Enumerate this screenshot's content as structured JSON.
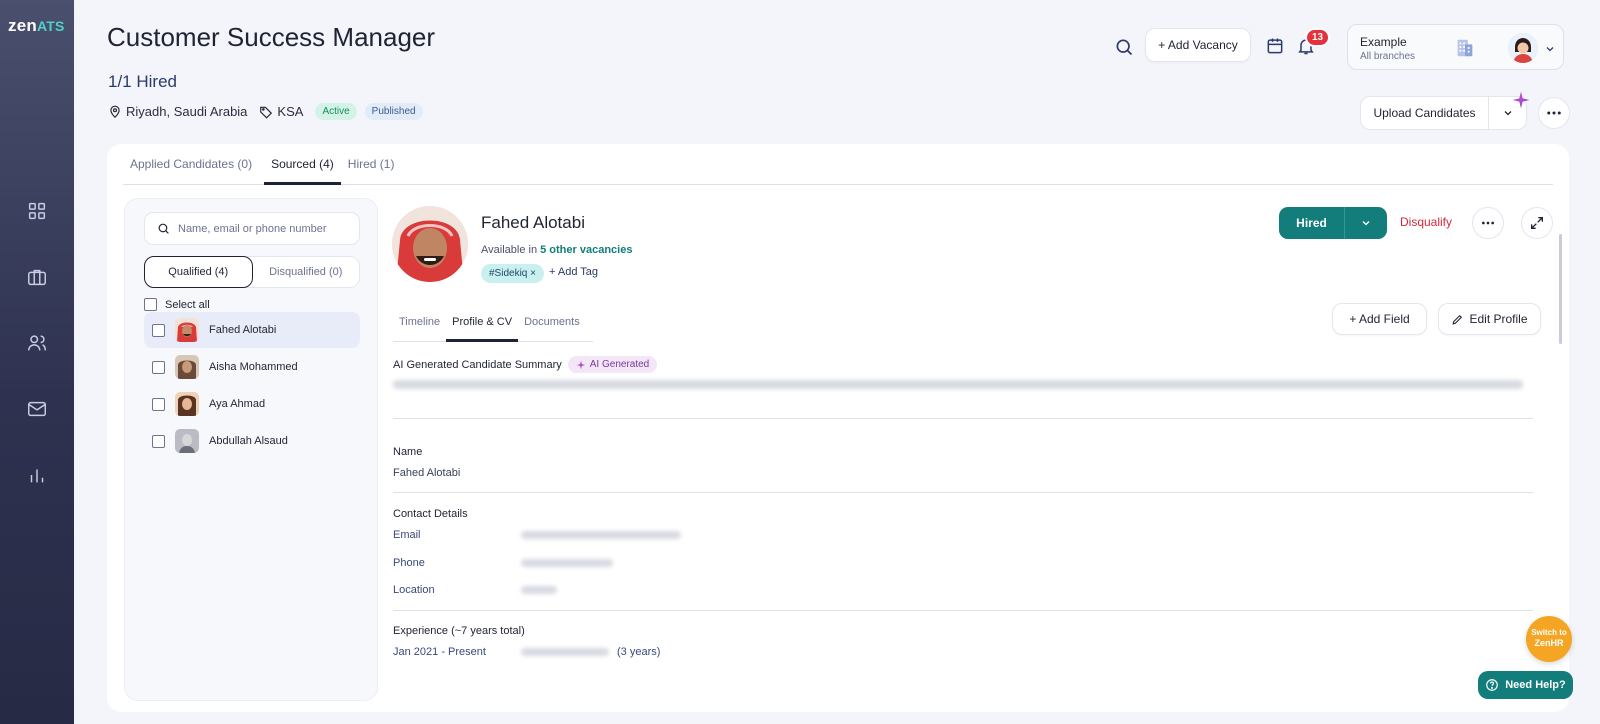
{
  "app": {
    "logo_main": "zen",
    "logo_accent": "ATS"
  },
  "sidebar": {
    "items": [
      {
        "icon": "dashboard-grid-icon"
      },
      {
        "icon": "briefcase-icon"
      },
      {
        "icon": "users-icon"
      },
      {
        "icon": "mail-icon"
      },
      {
        "icon": "bar-chart-icon"
      }
    ]
  },
  "header": {
    "title": "Customer Success Manager",
    "hired_count": "1/1 Hired",
    "location": "Riyadh, Saudi Arabia",
    "tag": "KSA",
    "status": "Active",
    "publish_status": "Published",
    "add_vacancy": "+ Add Vacancy",
    "notification_count": "13",
    "branch_name": "Example",
    "branch_sub": "All branches",
    "upload_label": "Upload Candidates"
  },
  "tabs": [
    {
      "label": "Applied Candidates (0)"
    },
    {
      "label": "Sourced (4)"
    },
    {
      "label": "Hired (1)"
    }
  ],
  "candidate_list": {
    "search_placeholder": "Name, email or phone number",
    "qualified": "Qualified (4)",
    "disqualified": "Disqualified (0)",
    "select_all": "Select all",
    "items": [
      {
        "name": "Fahed Alotabi"
      },
      {
        "name": "Aisha Mohammed"
      },
      {
        "name": "Aya Ahmad"
      },
      {
        "name": "Abdullah Alsaud"
      }
    ]
  },
  "profile": {
    "name": "Fahed Alotabi",
    "available_prefix": "Available in",
    "available_link": "5 other vacancies",
    "tag": "#Sidekiq ×",
    "add_tag": "+ Add Tag",
    "hired_label": "Hired",
    "disqualify": "Disqualify",
    "tabs": [
      {
        "label": "Timeline"
      },
      {
        "label": "Profile & CV"
      },
      {
        "label": "Documents"
      }
    ],
    "add_field": "+ Add Field",
    "edit_profile": "Edit Profile",
    "ai_summary_title": "AI Generated Candidate Summary",
    "ai_badge": "AI Generated",
    "name_section": "Name",
    "name_value": "Fahed Alotabi",
    "contact_section": "Contact Details",
    "email_label": "Email",
    "phone_label": "Phone",
    "location_label": "Location",
    "experience_section": "Experience (~7 years total)",
    "exp_period": "Jan 2021 - Present",
    "exp_years": "(3 years)"
  },
  "floating": {
    "switch_line1": "Switch to",
    "switch_line2": "ZenHR",
    "help": "Need Help?"
  }
}
